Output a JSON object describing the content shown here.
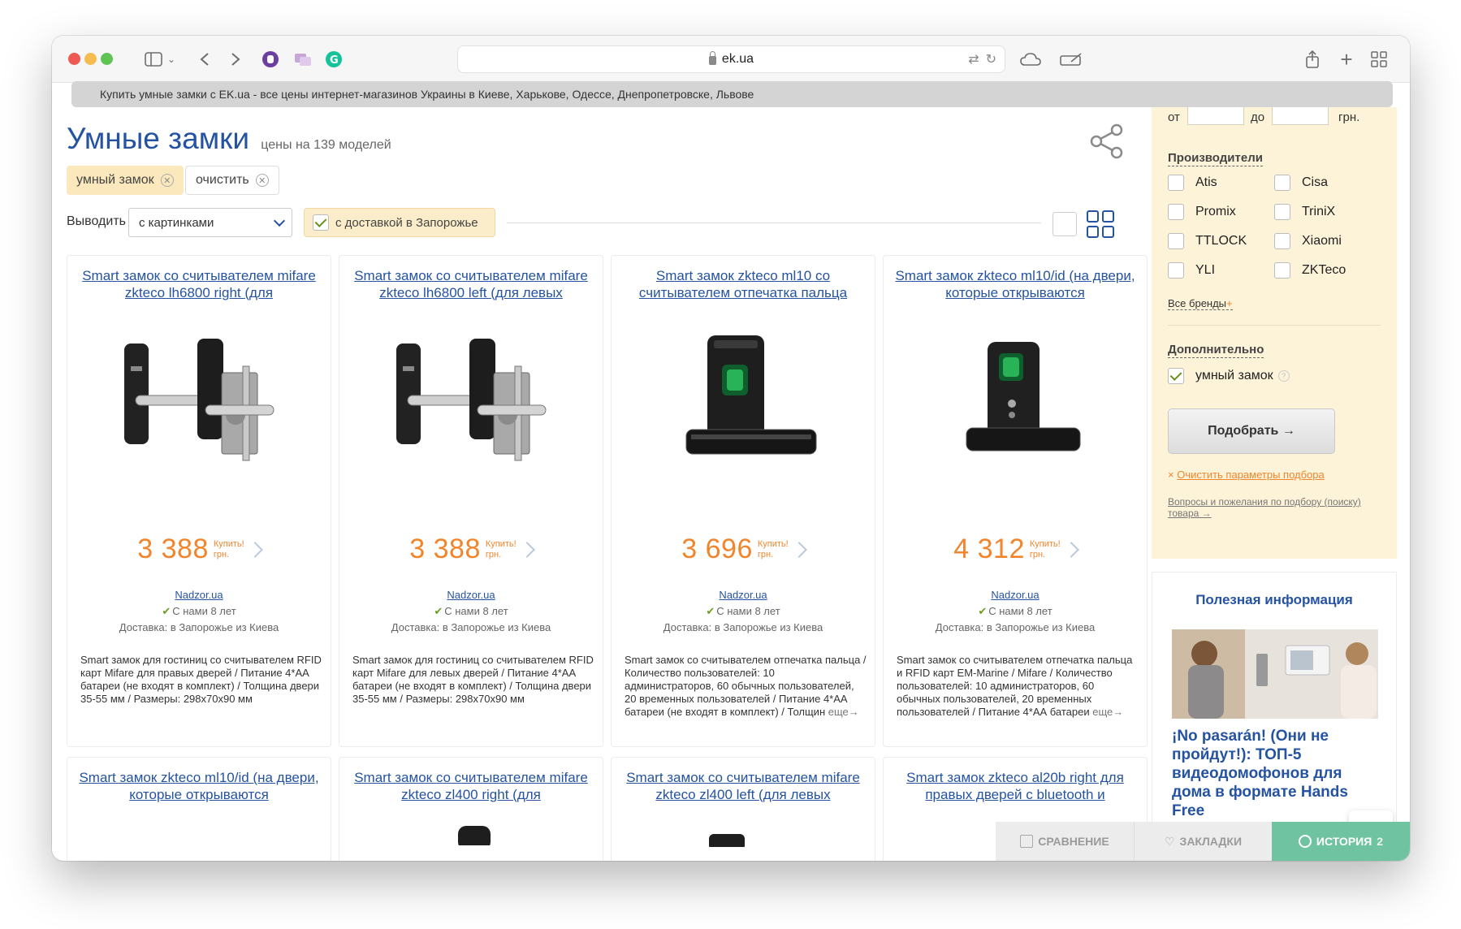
{
  "browser": {
    "url": "ek.ua",
    "tab_title": "Купить умные замки с EK.ua - все цены интернет-магазинов Украины в Киеве, Харькове, Одессе, Днепропетровске, Львове"
  },
  "header": {
    "title": "Умные замки",
    "subtitle": "цены на 139 моделей"
  },
  "chips": [
    {
      "label": "умный замок"
    },
    {
      "label": "очистить"
    }
  ],
  "controls": {
    "output_label": "Выводить",
    "view_select": "с картинками",
    "delivery_filter": "с доставкой в Запорожье"
  },
  "products": [
    {
      "title": "Smart замок со считывателем mifare zkteco lh6800 right (для",
      "price": "3 388",
      "buy_label": "Купить!",
      "currency": "грн.",
      "shop": "Nadzor.ua",
      "years": "С нами 8 лет",
      "delivery": "Доставка: в Запорожье из Киева",
      "description": "Smart замок для гостиниц со считывателем RFID карт Mifare для правых дверей / Питание 4*АА батареи (не входят в комплект) / Толщина двери 35-55 мм / Размеры: 298x70x90 мм",
      "more": ""
    },
    {
      "title": "Smart замок со считывателем mifare zkteco lh6800 left (для левых",
      "price": "3 388",
      "buy_label": "Купить!",
      "currency": "грн.",
      "shop": "Nadzor.ua",
      "years": "С нами 8 лет",
      "delivery": "Доставка: в Запорожье из Киева",
      "description": "Smart замок для гостиниц со считывателем RFID карт Mifare для левых дверей / Питание 4*АА батареи (не входят в комплект) / Толщина двери 35-55 мм / Размеры: 298x70x90 мм",
      "more": ""
    },
    {
      "title": "Smart замок zkteco ml10 со считывателем отпечатка пальца",
      "price": "3 696",
      "buy_label": "Купить!",
      "currency": "грн.",
      "shop": "Nadzor.ua",
      "years": "С нами 8 лет",
      "delivery": "Доставка: в Запорожье из Киева",
      "description": "Smart замок со считывателем отпечатка пальца / Количество пользователей: 10 администраторов, 60 обычных пользователей, 20 временных пользователей / Питание 4*АА батареи (не входят в комплект) / Толщин",
      "more": "еще→"
    },
    {
      "title": "Smart замок zkteco ml10/id (на двери, которые открываются",
      "price": "4 312",
      "buy_label": "Купить!",
      "currency": "грн.",
      "shop": "Nadzor.ua",
      "years": "С нами 8 лет",
      "delivery": "Доставка: в Запорожье из Киева",
      "description": "Smart замок со считывателем отпечатка пальца и RFID карт EM-Marine / Mifare / Количество пользователей: 10 администраторов, 60 обычных пользователей, 20 временных пользователей / Питание 4*АА батареи",
      "more": "еще→"
    }
  ],
  "products_row2": [
    {
      "title": "Smart замок zkteco ml10/id (на двери, которые открываются"
    },
    {
      "title": "Smart замок со считывателем mifare zkteco zl400 right (для"
    },
    {
      "title": "Smart замок со считывателем mifare zkteco zl400 left (для левых"
    },
    {
      "title": "Smart замок zkteco al20b right для правых дверей с bluetooth и"
    }
  ],
  "filter": {
    "from_label": "от",
    "to_label": "до",
    "currency": "грн.",
    "brands_title": "Производители",
    "brands": [
      "Atis",
      "Cisa",
      "Promix",
      "TriniX",
      "TTLOCK",
      "Xiaomi",
      "YLI",
      "ZKTeco"
    ],
    "all_brands": "Все бренды",
    "extra_title": "Дополнительно",
    "extra_option": "умный замок",
    "submit": "Подобрать →",
    "clear": "Очистить параметры подбора",
    "feedback": "Вопросы и пожелания по подбору (поиску) товара →"
  },
  "info": {
    "title": "Полезная информация",
    "article": "¡No pasarán! (Они не пройдут!): ТОП-5 видеодомофонов для дома в формате Hands Free"
  },
  "bottom_bar": {
    "compare": "СРАВНЕНИЕ",
    "bookmarks": "ЗАКЛАДКИ",
    "history": "ИСТОРИЯ",
    "history_count": "2"
  },
  "colors": {
    "accent": "#2553a2",
    "price": "#f2852c",
    "filter_bg": "#fdf3d9",
    "history_tab": "#6fc3a0"
  }
}
